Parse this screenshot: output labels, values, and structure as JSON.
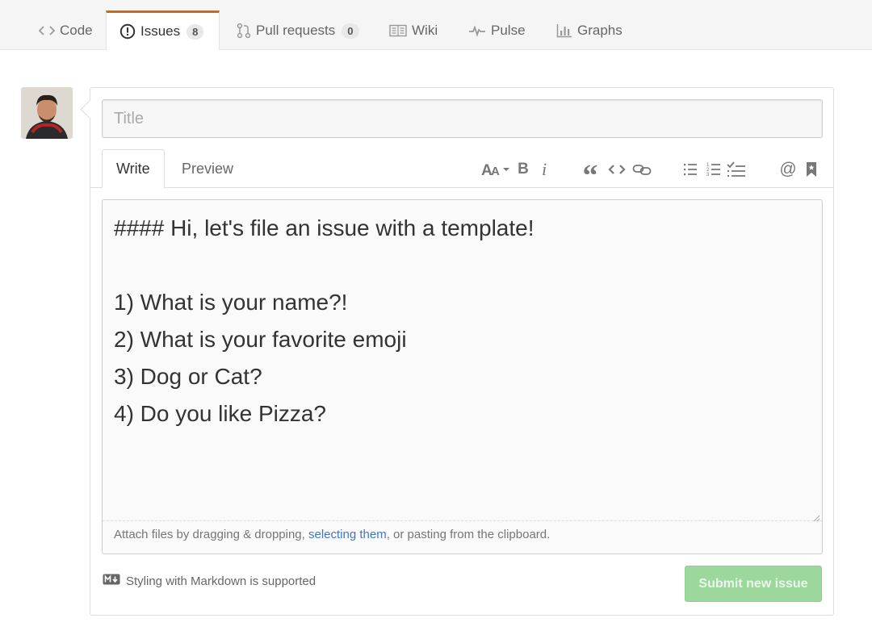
{
  "nav": {
    "tabs": [
      {
        "label": "Code",
        "icon": "code-icon"
      },
      {
        "label": "Issues",
        "icon": "issue-opened-icon",
        "count": "8",
        "selected": true
      },
      {
        "label": "Pull requests",
        "icon": "git-pull-request-icon",
        "count": "0"
      },
      {
        "label": "Wiki",
        "icon": "book-icon"
      },
      {
        "label": "Pulse",
        "icon": "pulse-icon"
      },
      {
        "label": "Graphs",
        "icon": "graph-icon"
      }
    ]
  },
  "form": {
    "title_placeholder": "Title",
    "tabs": {
      "write": "Write",
      "preview": "Preview"
    },
    "toolbar": [
      "text-size-icon",
      "bold-icon",
      "italic-icon",
      "quote-icon",
      "code-icon",
      "link-icon",
      "unordered-list-icon",
      "ordered-list-icon",
      "tasklist-icon",
      "mention-icon",
      "saved-reply-icon"
    ],
    "body": "#### Hi, let's file an issue with a template!\n\n1) What is your name?!\n2) What is your favorite emoji\n3) Dog or Cat?\n4) Do you like Pizza?",
    "attach": {
      "before": "Attach files by dragging & dropping, ",
      "link": "selecting them",
      "after": ", or pasting from the clipboard."
    },
    "markdown_note": "Styling with Markdown is supported",
    "submit_label": "Submit new issue"
  },
  "colors": {
    "accent": "#d26911",
    "link": "#4078c0",
    "submit_disabled": "#9cd79c"
  }
}
